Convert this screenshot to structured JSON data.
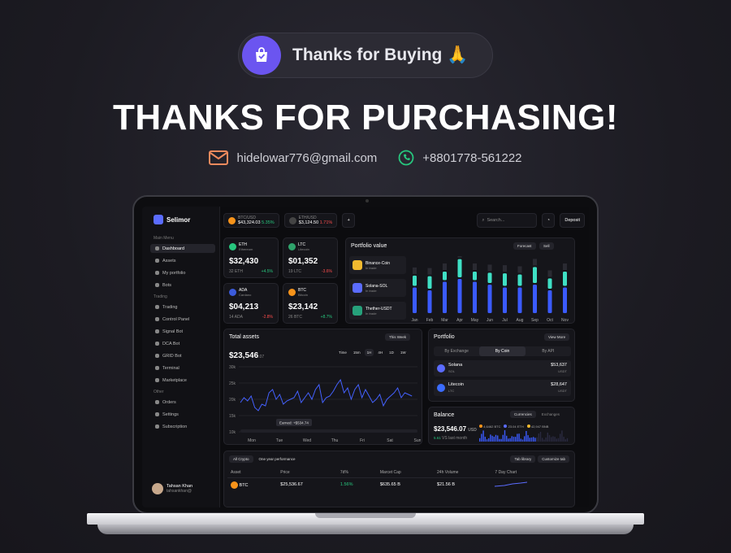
{
  "banner": {
    "pill_text": "Thanks for Buying",
    "emoji": "🙏",
    "headline": "THANKS FOR PURCHASING!",
    "email": "hidelowar776@gmail.com",
    "phone": "+8801778-561222"
  },
  "colors": {
    "accent": "#6b55f0",
    "email_icon": "#f08a5d",
    "phone_icon": "#27c77e",
    "pos": "#27c77e",
    "neg": "#ff4d4d"
  },
  "dash": {
    "brand": "Selimor",
    "sections": {
      "main": "Main Menu",
      "trading": "Trading",
      "other": "Other"
    },
    "nav_main": [
      "Dashboard",
      "Assets",
      "My portfolio",
      "Bots"
    ],
    "nav_trading": [
      "Trading",
      "Control Panel",
      "Signal Bot",
      "DCA Bot",
      "GRID Bot",
      "Terminal",
      "Marketplace"
    ],
    "nav_other": [
      "Orders",
      "Settings",
      "Subscription"
    ],
    "user": {
      "name": "Tahsan Khan",
      "handle": "tahsankhan@"
    },
    "tickers": [
      {
        "pair": "BTC/USD",
        "price": "$43,324.03",
        "chg": "5.35%",
        "dir": "pos"
      },
      {
        "pair": "ETH/USD",
        "price": "$3,124.50",
        "chg": "1.71%",
        "dir": "neg"
      }
    ],
    "search": "Search...",
    "deposit": "Deposit",
    "assets": [
      {
        "sym": "ETH",
        "name": "Ethereum",
        "val": "$32,430",
        "amt": "32 ETH",
        "chg": "+4.5%",
        "dir": "pos",
        "color": "#27c77e"
      },
      {
        "sym": "LTC",
        "name": "Litecoin",
        "val": "$01,352",
        "amt": "19 LTC",
        "chg": "-3.6%",
        "dir": "neg",
        "color": "#2fa36b"
      },
      {
        "sym": "ADA",
        "name": "Cardano",
        "val": "$04,213",
        "amt": "14 ADA",
        "chg": "-2.8%",
        "dir": "neg",
        "color": "#3b5bdb"
      },
      {
        "sym": "BTC",
        "name": "Bitcoin",
        "val": "$23,142",
        "amt": "26 BTC",
        "chg": "+8.7%",
        "dir": "pos",
        "color": "#f7931a"
      }
    ],
    "pv": {
      "title": "Portfolio value",
      "forecast": "Forecast",
      "sell": "Sell",
      "coins": [
        {
          "name": "Binance-Coin",
          "sub": "In trade"
        },
        {
          "name": "Solana-SOL",
          "sub": "In trade"
        },
        {
          "name": "Thether-USDT",
          "sub": "In trade"
        }
      ],
      "months": [
        "Jan",
        "Feb",
        "Mar",
        "Apr",
        "May",
        "Jun",
        "Jul",
        "Aug",
        "Sep",
        "Oct",
        "Nov"
      ],
      "blue": [
        0.45,
        0.4,
        0.55,
        0.6,
        0.55,
        0.5,
        0.45,
        0.45,
        0.5,
        0.4,
        0.45
      ],
      "teal": [
        0.18,
        0.22,
        0.15,
        0.32,
        0.15,
        0.18,
        0.22,
        0.2,
        0.28,
        0.18,
        0.25
      ]
    },
    "ta": {
      "title": "Total assets",
      "period": "This Week",
      "value": "$23,546",
      "cents": ".07",
      "ranges": [
        "Time",
        "15m",
        "1H",
        "4H",
        "1D",
        "1W"
      ],
      "yticks": [
        "30k",
        "25k",
        "20k",
        "15k",
        "10k"
      ],
      "days": [
        "Mon",
        "Tue",
        "Wed",
        "Thu",
        "Fri",
        "Sat",
        "Sun"
      ],
      "earned": "Earned: +$534.74"
    },
    "pf": {
      "title": "Portfolio",
      "view_more": "View More",
      "tabs": [
        "By Exchange",
        "By Coin",
        "By API"
      ],
      "rows": [
        {
          "name": "Solana",
          "sym": "SOL",
          "val": "$53,637",
          "unit": "USDT"
        },
        {
          "name": "Litecoin",
          "sym": "LTC",
          "val": "$28,647",
          "unit": "USDT"
        }
      ]
    },
    "bal": {
      "title": "Balance",
      "tabs": [
        "Currencies",
        "Exchanges"
      ],
      "value": "$23,546.07",
      "unit": "USD",
      "delta": "5.61",
      "delta_txt": "VS last month",
      "legend": [
        {
          "l": "4,6462 BTC",
          "c": "#f7931a"
        },
        {
          "l": "23.04 ETH",
          "c": "#5b6cff"
        },
        {
          "l": "42,947 BNB",
          "c": "#f3ba2f"
        }
      ]
    },
    "table": {
      "tabs": [
        "All Crypto",
        "One year performance"
      ],
      "tab_library": "Tab library",
      "customize": "Customize tab",
      "headers": [
        "Asset",
        "Price",
        "7d%",
        "Marcet Cap",
        "24h Volume",
        "7 Day Chart"
      ],
      "row": {
        "asset": "BTC",
        "name": "Bitcoin",
        "price": "$25,536.67",
        "chg": "1.56%",
        "cap": "$635.65 B",
        "vol": "$21.56 B"
      }
    }
  }
}
